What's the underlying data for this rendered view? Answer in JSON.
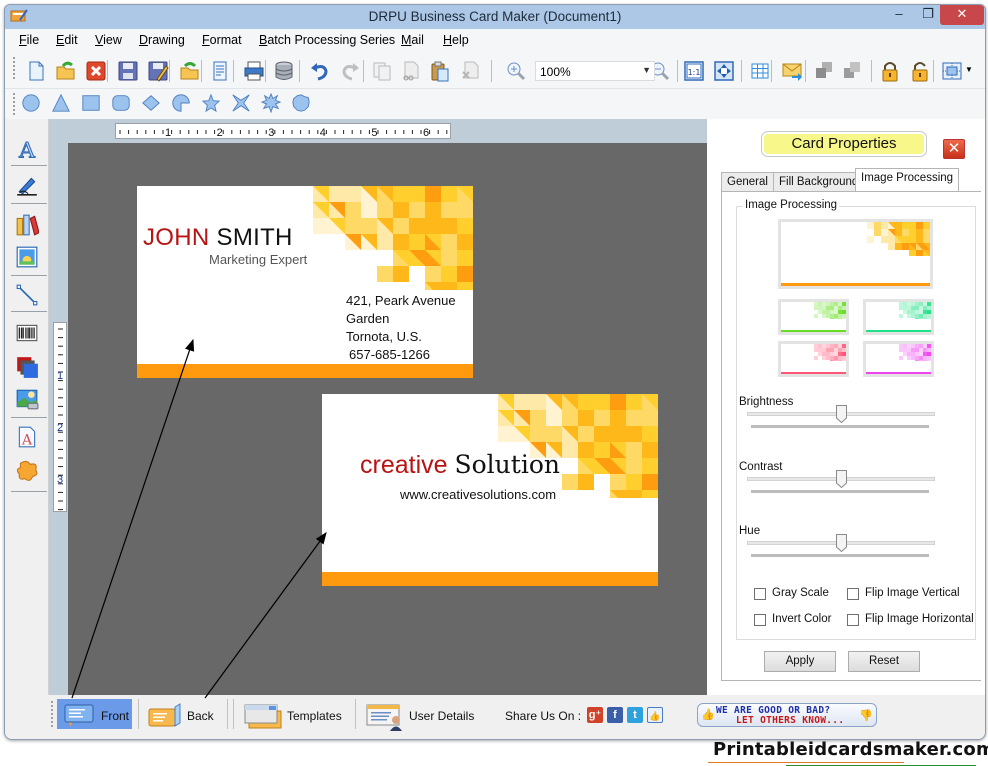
{
  "window": {
    "title": "DRPU Business Card Maker (Document1)",
    "controls": {
      "minimize": "–",
      "maximize": "❐",
      "close": "✕"
    }
  },
  "menu": [
    {
      "label": "File",
      "accel": "F",
      "rest": "ile"
    },
    {
      "label": "Edit",
      "accel": "E",
      "rest": "dit"
    },
    {
      "label": "View",
      "accel": "V",
      "rest": "iew"
    },
    {
      "label": "Drawing",
      "accel": "D",
      "rest": "rawing"
    },
    {
      "label": "Format",
      "accel": "F",
      "rest": "ormat"
    },
    {
      "label": "Batch Processing Series",
      "accel": "B",
      "rest": "atch Processing Series"
    },
    {
      "label": "Mail",
      "accel": "M",
      "rest": "ail"
    },
    {
      "label": "Help",
      "accel": "H",
      "rest": "elp"
    }
  ],
  "toolbar": {
    "buttons": [
      "new-icon",
      "open-icon",
      "close-document-icon",
      "save-icon",
      "save-as-icon",
      "export-icon",
      "properties-icon",
      "print-icon",
      "database-icon",
      "undo-icon",
      "redo-icon",
      "copy-icon",
      "cut-icon",
      "paste-icon",
      "delete-icon",
      "zoom-in-icon",
      "zoom-out-icon",
      "actual-size-icon",
      "fit-to-window-icon",
      "grid-icon",
      "email-icon",
      "bring-forward-icon",
      "send-backward-icon",
      "lock-icon",
      "unlock-icon",
      "alignment-icon"
    ],
    "zoom_value": "100%"
  },
  "shapes_toolbar": [
    "ellipse-icon",
    "triangle-icon",
    "rectangle-icon",
    "rounded-rectangle-icon",
    "diamond-icon",
    "pie-icon",
    "star-icon",
    "four-point-star-icon",
    "burst-icon",
    "polygon-icon"
  ],
  "left_toolbar": [
    "text-icon",
    "signature-icon",
    "library-icon",
    "image-icon",
    "line-icon",
    "barcode-icon",
    "watermark-icon",
    "picture-icon",
    "text-document-icon",
    "sticker-icon"
  ],
  "rulers": {
    "horizontal_labels": [
      "1",
      "2",
      "3",
      "4",
      "5",
      "6"
    ],
    "vertical_labels": [
      "1",
      "2",
      "3"
    ]
  },
  "cards": {
    "front": {
      "first_name": "JOHN",
      "last_name": "SMITH",
      "title": "Marketing Expert",
      "address_line1": "421, Peark Avenue",
      "address_line2": "Garden",
      "city": "Tornota, U.S.",
      "phone": "657-685-1266"
    },
    "back": {
      "company_word1": "creative",
      "company_word2": "Solution",
      "website": "www.creativesolutions.com"
    },
    "accent_color": "#ff9a0e",
    "name_color": "#b81414"
  },
  "properties": {
    "title": "Card Properties",
    "tabs": [
      {
        "label": "General",
        "active": false
      },
      {
        "label": "Fill Background",
        "active": false
      },
      {
        "label": "Image Processing",
        "active": true
      }
    ],
    "group_label": "Image Processing",
    "thumb_tints": [
      "#66dd22",
      "#22e088",
      "#ff5577",
      "#ee44ee"
    ],
    "sliders": [
      {
        "label": "Brightness",
        "value": 0.5
      },
      {
        "label": "Contrast",
        "value": 0.5
      },
      {
        "label": "Hue",
        "value": 0.5
      }
    ],
    "checkboxes": [
      {
        "label": "Gray Scale",
        "checked": false
      },
      {
        "label": "Flip Image Vertical",
        "checked": false
      },
      {
        "label": "Invert Color",
        "checked": false
      },
      {
        "label": "Flip Image Horizontal",
        "checked": false
      }
    ],
    "apply_label": "Apply",
    "reset_label": "Reset"
  },
  "bottom": {
    "tabs": [
      {
        "label": "Front",
        "active": true
      },
      {
        "label": "Back",
        "active": false
      },
      {
        "label": "Templates",
        "active": false
      },
      {
        "label": "User Details",
        "active": false
      }
    ],
    "share_label": "Share Us On :",
    "share_icons": [
      {
        "name": "google-plus-icon",
        "glyph": "g⁺",
        "color": "#d0422a"
      },
      {
        "name": "facebook-icon",
        "glyph": "f",
        "color": "#3b5ea8"
      },
      {
        "name": "twitter-icon",
        "glyph": "t",
        "color": "#2fa2dd"
      },
      {
        "name": "like-icon",
        "glyph": "👍",
        "color": "#4a7cc4"
      }
    ],
    "feedback_line1": "WE ARE GOOD OR BAD?",
    "feedback_line2": "LET OTHERS KNOW..."
  },
  "footer": {
    "brand": "Printableidcardsmaker.com"
  }
}
